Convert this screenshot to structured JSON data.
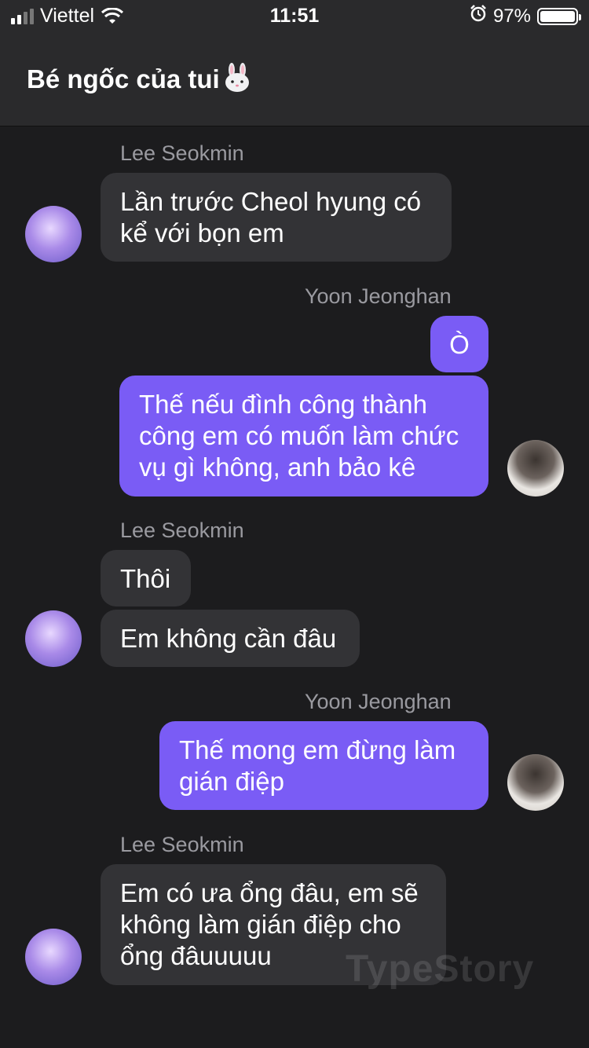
{
  "status": {
    "carrier": "Viettel",
    "time": "11:51",
    "battery": "97%",
    "battery_level": 0.97
  },
  "header": {
    "title": "Bé ngốc của tui",
    "title_icon": "rabbit-face-icon"
  },
  "messages": [
    {
      "sender": "Lee Seokmin",
      "text": "Lần trước Cheol hyung có\nkể với bọn em"
    },
    {
      "sender": "Yoon Jeonghan",
      "text": "Ò"
    },
    {
      "text": "Thế nếu đình công thành\ncông em có muốn làm chức\nvụ gì không, anh bảo kê"
    },
    {
      "sender": "Lee Seokmin",
      "text": "Thôi"
    },
    {
      "text": "Em không cần đâu"
    },
    {
      "sender": "Yoon Jeonghan",
      "text": "Thế mong em đừng làm\ngián điệp"
    },
    {
      "sender": "Lee Seokmin",
      "text": "Em có ưa ổng đâu, em sẽ\nkhông làm gián điệp cho\nổng đâuuuuu"
    }
  ],
  "watermark": "TypeStory",
  "colors": {
    "background": "#1c1c1e",
    "header": "#2a2a2c",
    "incoming_bubble": "#333336",
    "outgoing_bubble": "#7a5cf5",
    "sender_name": "#9a9aa0"
  }
}
